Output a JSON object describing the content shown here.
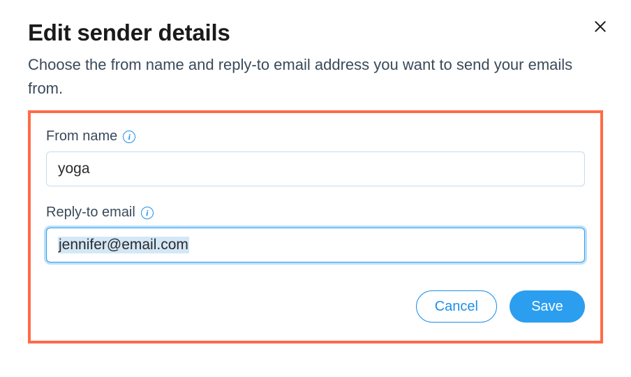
{
  "dialog": {
    "title": "Edit sender details",
    "subtitle": "Choose the from name and reply-to email address you want to send your emails from."
  },
  "form": {
    "from_name": {
      "label": "From name",
      "value": "yoga"
    },
    "reply_to": {
      "label": "Reply-to email",
      "value": "jennifer@email.com"
    }
  },
  "actions": {
    "cancel": "Cancel",
    "save": "Save"
  }
}
